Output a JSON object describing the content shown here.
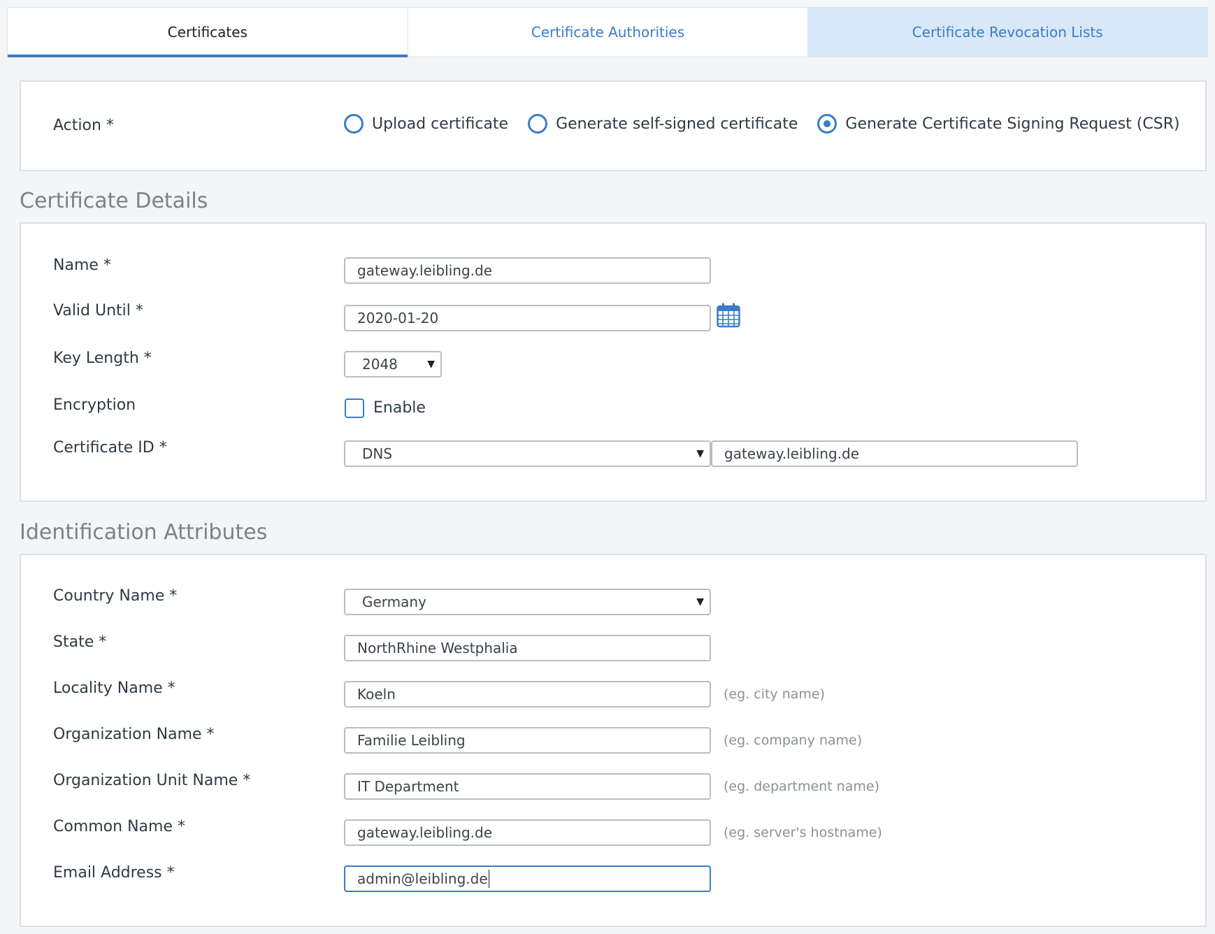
{
  "tabs": [
    {
      "label": "Certificates"
    },
    {
      "label": "Certificate Authorities"
    },
    {
      "label": "Certificate Revocation Lists"
    }
  ],
  "action": {
    "label": "Action *",
    "options": [
      {
        "label": "Upload certificate",
        "checked": false
      },
      {
        "label": "Generate self-signed certificate",
        "checked": false
      },
      {
        "label": "Generate Certificate Signing Request (CSR)",
        "checked": true
      }
    ]
  },
  "certificate_details": {
    "title": "Certificate Details",
    "name_label": "Name *",
    "name_value": "gateway.leibling.de",
    "valid_until_label": "Valid Until *",
    "valid_until_value": "2020-01-20",
    "key_length_label": "Key Length *",
    "key_length_value": "2048",
    "encryption_label": "Encryption",
    "encryption_checkbox_label": "Enable",
    "certificate_id_label": "Certificate ID *",
    "certificate_id_type": "DNS",
    "certificate_id_value": "gateway.leibling.de"
  },
  "identification": {
    "title": "Identification Attributes",
    "country_label": "Country Name *",
    "country_value": "Germany",
    "state_label": "State *",
    "state_value": "NorthRhine Westphalia",
    "locality_label": "Locality Name *",
    "locality_value": "Koeln",
    "locality_hint": "(eg. city name)",
    "org_label": "Organization Name *",
    "org_value": "Familie Leibling",
    "org_hint": "(eg. company name)",
    "org_unit_label": "Organization Unit Name *",
    "org_unit_value": "IT Department",
    "org_unit_hint": "(eg. department name)",
    "common_name_label": "Common Name *",
    "common_name_value": "gateway.leibling.de",
    "common_name_hint": "(eg. server's hostname)",
    "email_label": "Email Address *",
    "email_value": "admin@leibling.de"
  },
  "icons": {
    "calendar": "calendar-icon",
    "dropdown": "chevron-down-icon"
  },
  "colors": {
    "accent": "#3a7cc7",
    "hover_tab_bg": "#d8e8f8"
  }
}
